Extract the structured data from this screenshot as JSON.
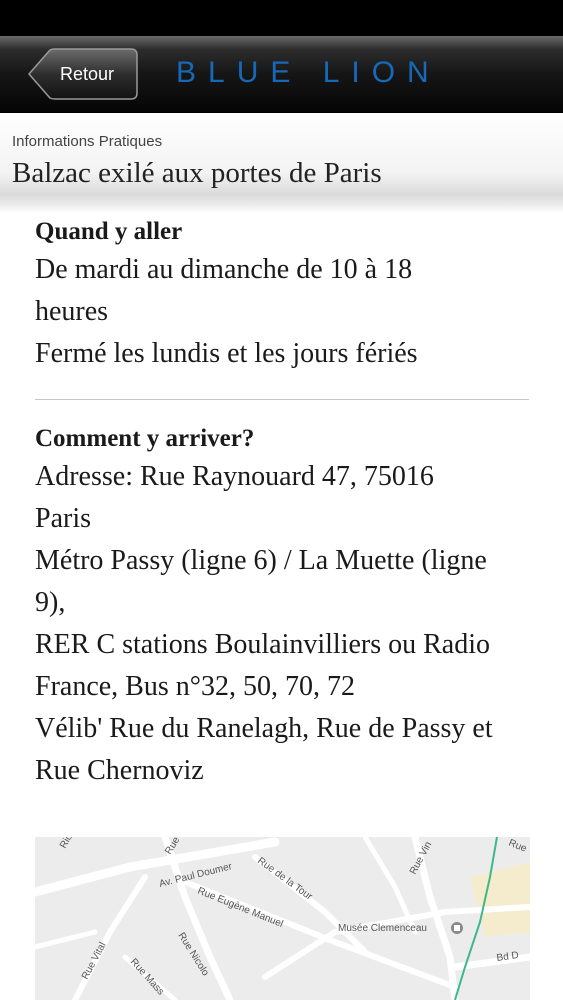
{
  "nav": {
    "back_label": "Retour",
    "brand": "BLUE LION"
  },
  "header": {
    "category": "Informations Pratiques",
    "title": "Balzac exilé aux portes de Paris"
  },
  "sections": [
    {
      "heading": "Quand y aller",
      "lines": [
        "De mardi au dimanche de 10 à 18",
        "heures",
        "Fermé les lundis et les jours fériés"
      ]
    },
    {
      "heading": "Comment y arriver?",
      "lines": [
        "Adresse: Rue Raynouard 47, 75016",
        "Paris",
        "Métro Passy (ligne 6) / La Muette (ligne",
        "9),",
        "RER C stations Boulainvilliers ou Radio",
        "France, Bus n°32, 50, 70, 72",
        "Vélib' Rue du Ranelagh, Rue de Passy et",
        "Rue Chernoviz"
      ]
    }
  ],
  "map": {
    "labels": {
      "top_left": "Rio",
      "rue_top": "Rue",
      "paul_doumer": "Av. Paul Doumer",
      "rue_de_la_tour": "Rue de la Tour",
      "eugene_manuel": "Rue Eugène Manuel",
      "rue_vin": "Rue Vin",
      "rue_right": "Rue",
      "musee": "Musée Clemenceau",
      "rue_nicolo": "Rue Nicolo",
      "rue_vital": "Rue Vital",
      "rue_mass": "Rue Mass",
      "bd": "Bd D"
    },
    "colors": {
      "background": "#ececec",
      "roads": "#ffffff",
      "transit": "#3cb88a",
      "park": "#f4eccd"
    }
  }
}
